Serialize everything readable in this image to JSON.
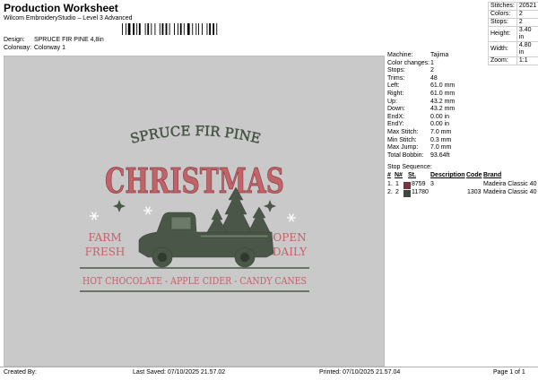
{
  "header": {
    "title": "Production Worksheet",
    "subtitle": "Wilcom EmbroideryStudio – Level 3 Advanced",
    "design_label": "Design:",
    "design_value": "SPRUCE FIR PINE 4,8in",
    "colorway_label": "Colorway:",
    "colorway_value": "Colorway 1"
  },
  "stats": [
    {
      "k": "Stitches:",
      "v": "20521"
    },
    {
      "k": "Colors:",
      "v": "2"
    },
    {
      "k": "Stops:",
      "v": "2"
    },
    {
      "k": "Height:",
      "v": "3.40 in"
    },
    {
      "k": "Width:",
      "v": "4.80 in"
    },
    {
      "k": "Zoom:",
      "v": "1:1"
    }
  ],
  "design_text": {
    "line1": "SPRUCE FIR PINE",
    "line2": "CHRISTMAS",
    "left_top": "FARM",
    "left_bottom": "FRESH",
    "right_top": "OPEN",
    "right_bottom": "DAILY",
    "bottom": "HOT CHOCOLATE - APPLE CIDER - CANDY CANES"
  },
  "info": [
    {
      "k": "Machine:",
      "v": "Tajima"
    },
    {
      "k": "Color changes:",
      "v": "1"
    },
    {
      "k": "Stops:",
      "v": "2"
    },
    {
      "k": "Trims:",
      "v": "48"
    },
    {
      "k": "Left:",
      "v": "61.0 mm"
    },
    {
      "k": "Right:",
      "v": "61.0 mm"
    },
    {
      "k": "Up:",
      "v": "43.2 mm"
    },
    {
      "k": "Down:",
      "v": "43.2 mm"
    },
    {
      "k": "EndX:",
      "v": "0.00 in"
    },
    {
      "k": "EndY:",
      "v": "0.00 in"
    },
    {
      "k": "Max Stitch:",
      "v": "7.0 mm"
    },
    {
      "k": "Min Stitch:",
      "v": "0.3 mm"
    },
    {
      "k": "Max Jump:",
      "v": "7.0 mm"
    },
    {
      "k": "Total Bobbin:",
      "v": "93.64ft"
    }
  ],
  "stop_sequence": {
    "title": "Stop Sequence:",
    "headers": {
      "hash": "#",
      "n": "N#",
      "st": "St.",
      "description": "Description",
      "code": "Code",
      "brand": "Brand"
    },
    "rows": [
      {
        "num": "1.",
        "n": "1",
        "st": "8759",
        "description": "3",
        "code": "",
        "brand": "Madeira Classic 40",
        "color": "#8b2c3a"
      },
      {
        "num": "2.",
        "n": "2",
        "st": "11780",
        "description": "",
        "code": "1303",
        "brand": "Madeira Classic 40",
        "color": "#3d4a3c"
      }
    ]
  },
  "footer": {
    "created": "Created By:",
    "saved": "Last Saved: 07/10/2025 21.57.02",
    "printed": "Printed: 07/10/2025 21.57.04",
    "page": "Page 1 of 1"
  },
  "colors": {
    "red_thread": "#b8545a",
    "green_thread": "#4a5748",
    "panel_bg": "#c9c9c9"
  }
}
